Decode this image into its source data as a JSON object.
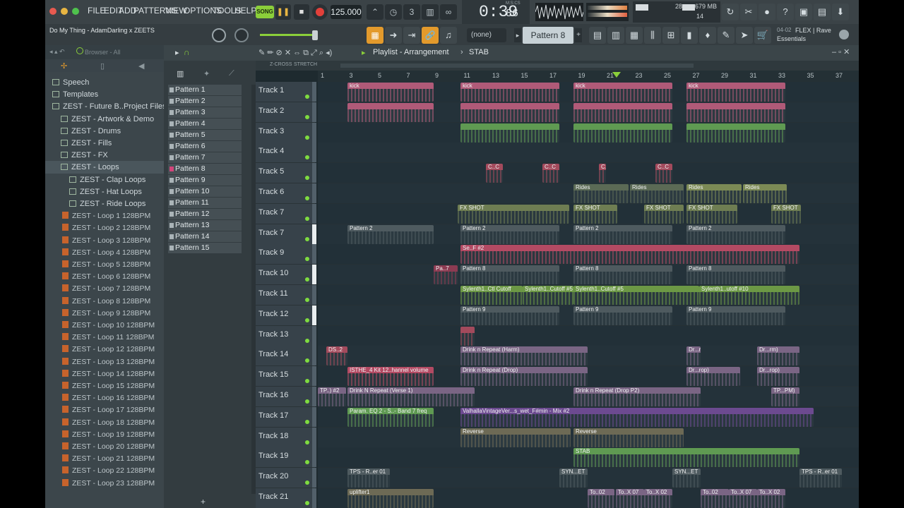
{
  "menu": [
    "FILE",
    "EDIT",
    "ADD",
    "PATTERNS",
    "VIEW",
    "OPTIONS",
    "TOOLS",
    "HELP"
  ],
  "transport": {
    "song_label": "SONG",
    "tempo": "125.000",
    "time": "0:39",
    "time_frac": "86",
    "time_unit": "M:S:CS",
    "cpu": "28",
    "ram": "679 MB",
    "poly": "14"
  },
  "project": {
    "hint": "Do My Thing - AdamDarling x ZEETS"
  },
  "pattern_selector": {
    "none_label": "(none)",
    "current": "Pattern 8"
  },
  "news": {
    "date": "04-02",
    "line1": "FLEX | Rave",
    "line2": "Essentials"
  },
  "browser": {
    "title": "Browser - All",
    "items": [
      {
        "label": "Speech",
        "type": "folder"
      },
      {
        "label": "Templates",
        "type": "folder"
      },
      {
        "label": "ZEST - Future B..Project Files]",
        "type": "folder"
      },
      {
        "label": "ZEST - Artwork & Demo",
        "type": "folder"
      },
      {
        "label": "ZEST - Drums",
        "type": "folder"
      },
      {
        "label": "ZEST - Fills",
        "type": "folder"
      },
      {
        "label": "ZEST - FX",
        "type": "folder"
      },
      {
        "label": "ZEST - Loops",
        "type": "folder"
      },
      {
        "label": "ZEST - Clap Loops",
        "type": "folder"
      },
      {
        "label": "ZEST - Hat Loops",
        "type": "folder"
      },
      {
        "label": "ZEST - Ride Loops",
        "type": "folder"
      },
      {
        "label": "ZEST - Loop 1 128BPM",
        "type": "loop"
      },
      {
        "label": "ZEST - Loop 2 128BPM",
        "type": "loop"
      },
      {
        "label": "ZEST - Loop 3 128BPM",
        "type": "loop"
      },
      {
        "label": "ZEST - Loop 4 128BPM",
        "type": "loop"
      },
      {
        "label": "ZEST - Loop 5 128BPM",
        "type": "loop"
      },
      {
        "label": "ZEST - Loop 6 128BPM",
        "type": "loop"
      },
      {
        "label": "ZEST - Loop 7 128BPM",
        "type": "loop"
      },
      {
        "label": "ZEST - Loop 8 128BPM",
        "type": "loop"
      },
      {
        "label": "ZEST - Loop 9 128BPM",
        "type": "loop"
      },
      {
        "label": "ZEST - Loop 10 128BPM",
        "type": "loop"
      },
      {
        "label": "ZEST - Loop 11 128BPM",
        "type": "loop"
      },
      {
        "label": "ZEST - Loop 12 128BPM",
        "type": "loop"
      },
      {
        "label": "ZEST - Loop 13 128BPM",
        "type": "loop"
      },
      {
        "label": "ZEST - Loop 14 128BPM",
        "type": "loop"
      },
      {
        "label": "ZEST - Loop 15 128BPM",
        "type": "loop"
      },
      {
        "label": "ZEST - Loop 16 128BPM",
        "type": "loop"
      },
      {
        "label": "ZEST - Loop 17 128BPM",
        "type": "loop"
      },
      {
        "label": "ZEST - Loop 18 128BPM",
        "type": "loop"
      },
      {
        "label": "ZEST - Loop 19 128BPM",
        "type": "loop"
      },
      {
        "label": "ZEST - Loop 20 128BPM",
        "type": "loop"
      },
      {
        "label": "ZEST - Loop 21 128BPM",
        "type": "loop"
      },
      {
        "label": "ZEST - Loop 22 128BPM",
        "type": "loop"
      },
      {
        "label": "ZEST - Loop 23 128BPM",
        "type": "loop"
      }
    ]
  },
  "patterns": [
    "Pattern 1",
    "Pattern 2",
    "Pattern 3",
    "Pattern 4",
    "Pattern 5",
    "Pattern 6",
    "Pattern 7",
    "Pattern 8",
    "Pattern 9",
    "Pattern 10",
    "Pattern 11",
    "Pattern 12",
    "Pattern 13",
    "Pattern 14",
    "Pattern 15"
  ],
  "playlist": {
    "title": "Playlist - Arrangement",
    "crumb": "STAB",
    "zcross": "Z-CROSS",
    "stretch": "STRETCH",
    "ruler": [
      "1",
      "3",
      "5",
      "7",
      "9",
      "11",
      "13",
      "15",
      "17",
      "19",
      "21",
      "23",
      "25",
      "27",
      "29",
      "31",
      "33",
      "35",
      "37"
    ],
    "tracks": [
      {
        "name": "Track 1",
        "clips": [
          {
            "label": "kick",
            "color": "#b05a78"
          },
          {
            "label": "kick",
            "color": "#b05a78"
          },
          {
            "label": "kick",
            "color": "#b05a78"
          },
          {
            "label": "kick",
            "color": "#b05a78"
          }
        ]
      },
      {
        "name": "Track 2",
        "clips": [
          {
            "label": "",
            "color": "#b05a78"
          },
          {
            "label": "",
            "color": "#b05a78"
          },
          {
            "label": "",
            "color": "#b05a78"
          },
          {
            "label": "",
            "color": "#b05a78"
          }
        ]
      },
      {
        "name": "Track 3",
        "clips": [
          {
            "label": "",
            "color": "#5f9a52"
          },
          {
            "label": "",
            "color": "#5f9a52"
          },
          {
            "label": "",
            "color": "#5f9a52"
          }
        ]
      },
      {
        "name": "Track 4",
        "clips": []
      },
      {
        "name": "Track 5",
        "clips": [
          {
            "label": "C..C",
            "color": "#a34a5c"
          },
          {
            "label": "C..C",
            "color": "#a34a5c"
          },
          {
            "label": "C..C",
            "color": "#a34a5c"
          },
          {
            "label": "C..C",
            "color": "#a34a5c"
          }
        ]
      },
      {
        "name": "Track 6",
        "clips": [
          {
            "label": "Rides",
            "color": "#5b6a55"
          },
          {
            "label": "Rides",
            "color": "#5b6a55"
          },
          {
            "label": "Rides",
            "color": "#7c8a55"
          },
          {
            "label": "Rides",
            "color": "#7c8a55"
          }
        ]
      },
      {
        "name": "Track 7",
        "clips": [
          {
            "label": "FX SHOT",
            "color": "#6e7d52"
          },
          {
            "label": "FX SHOT",
            "color": "#6e7d52"
          },
          {
            "label": "FX SHOT",
            "color": "#6e7d52"
          },
          {
            "label": "FX SHOT",
            "color": "#6e7d52"
          },
          {
            "label": "FX SHOT",
            "color": "#6e7d52"
          }
        ]
      },
      {
        "name": "Track 7",
        "clips": [
          {
            "label": "Pattern 2",
            "color": "#4e5a5f"
          },
          {
            "label": "Pattern 2",
            "color": "#4e5a5f"
          },
          {
            "label": "Pattern 2",
            "color": "#4e5a5f"
          },
          {
            "label": "Pattern 2",
            "color": "#4e5a5f"
          }
        ]
      },
      {
        "name": "Track 9",
        "clips": [
          {
            "label": "Se..F #2",
            "color": "#b34a63"
          }
        ]
      },
      {
        "name": "Track 10",
        "clips": [
          {
            "label": "Pa..7",
            "color": "#8c3b52"
          },
          {
            "label": "Pattern 8",
            "color": "#4e5a5f"
          },
          {
            "label": "Pattern 8",
            "color": "#4e5a5f"
          },
          {
            "label": "Pattern 8",
            "color": "#4e5a5f"
          }
        ]
      },
      {
        "name": "Track 11",
        "clips": [
          {
            "label": "Sylenth1..Ctl Cutoff",
            "color": "#6c9845"
          },
          {
            "label": "Sylenth1..Cutoff #5",
            "color": "#6c9845"
          },
          {
            "label": "Sylenth1..Cutoff #5",
            "color": "#6c9845"
          },
          {
            "label": "Sylenth1..utoff #10",
            "color": "#6c9845"
          }
        ]
      },
      {
        "name": "Track 12",
        "clips": [
          {
            "label": "Pattern 9",
            "color": "#4e5a5f"
          },
          {
            "label": "Pattern 9",
            "color": "#4e5a5f"
          },
          {
            "label": "Pattern 9",
            "color": "#4e5a5f"
          }
        ]
      },
      {
        "name": "Track 13",
        "clips": [
          {
            "label": "",
            "color": "#a34a5c"
          }
        ]
      },
      {
        "name": "Track 14",
        "clips": [
          {
            "label": "DS..2",
            "color": "#a34a5c"
          },
          {
            "label": "Drink n Repeat (Harm)",
            "color": "#7a6584"
          },
          {
            "label": "Dr...rm)",
            "color": "#7a6584"
          },
          {
            "label": "Dr...rm)",
            "color": "#7a6584"
          }
        ]
      },
      {
        "name": "Track 15",
        "clips": [
          {
            "label": "ISTHE_4 Kit 12..hannel volume",
            "color": "#b34a63"
          },
          {
            "label": "Drink n Repeat (Drop)",
            "color": "#7a6584"
          },
          {
            "label": "Dr...rop)",
            "color": "#7a6584"
          },
          {
            "label": "Dr...rop)",
            "color": "#7a6584"
          }
        ]
      },
      {
        "name": "Track 16",
        "clips": [
          {
            "label": "TP..) #2",
            "color": "#7a6584"
          },
          {
            "label": "Drink N Repeat (Verse 1)",
            "color": "#7a6584"
          },
          {
            "label": "Drink n Repeat (Drop P2)",
            "color": "#7a6584"
          },
          {
            "label": "TP...PM)",
            "color": "#7a6584"
          }
        ]
      },
      {
        "name": "Track 17",
        "clips": [
          {
            "label": "Param. EQ 2 - S..- Band 7 freq",
            "color": "#5f9a52"
          },
          {
            "label": "ValhallaVintageVer...s_wet_F#min - Mix #2",
            "color": "#6c4a90"
          }
        ]
      },
      {
        "name": "Track 18",
        "clips": [
          {
            "label": "Reverse",
            "color": "#6d6a55"
          },
          {
            "label": "Reverse",
            "color": "#6d6a55"
          }
        ]
      },
      {
        "name": "Track 19",
        "clips": [
          {
            "label": "STAB",
            "color": "#5f9a52"
          }
        ]
      },
      {
        "name": "Track 20",
        "clips": [
          {
            "label": "TPS - R..er 01",
            "color": "#4e5a5f"
          },
          {
            "label": "SYN...ET",
            "color": "#4e5a5f"
          },
          {
            "label": "SYN...ET",
            "color": "#4e5a5f"
          },
          {
            "label": "TPS - R..er 01",
            "color": "#4e5a5f"
          }
        ]
      },
      {
        "name": "Track 21",
        "clips": [
          {
            "label": "uplifter1",
            "color": "#6d6a55"
          },
          {
            "label": "To..02",
            "color": "#7a6584"
          },
          {
            "label": "To..X 07",
            "color": "#7a6584"
          },
          {
            "label": "To..X 02",
            "color": "#7a6584"
          },
          {
            "label": "To..02",
            "color": "#7a6584"
          },
          {
            "label": "To..X 07",
            "color": "#7a6584"
          },
          {
            "label": "To..X 02",
            "color": "#7a6584"
          }
        ]
      }
    ]
  }
}
